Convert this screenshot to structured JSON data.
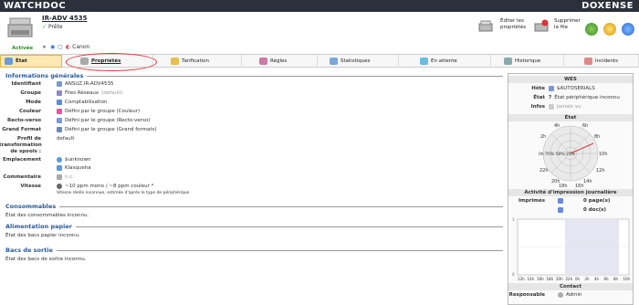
{
  "brand_left": "WATCHDOC",
  "brand_right": "DOXENSE",
  "printer": {
    "name": "IR-ADV 4535",
    "status": "Prête",
    "active_label": "Activée",
    "vendor": "Canon"
  },
  "header_actions": {
    "edit": "Éditer les propriétés",
    "delete": "Supprimer la file"
  },
  "tabs": [
    {
      "label": "État"
    },
    {
      "label": "Propriétés"
    },
    {
      "label": "Tarification"
    },
    {
      "label": "Règles"
    },
    {
      "label": "Statistiques"
    },
    {
      "label": "En attente"
    },
    {
      "label": "Historique"
    },
    {
      "label": "Incidents"
    }
  ],
  "general": {
    "title": "Informations générales",
    "rows": [
      {
        "k": "Identifiant",
        "v": "ANSUZ.IR-ADV4535"
      },
      {
        "k": "Groupe",
        "v": "Files Réseaux",
        "extra": "(default)"
      },
      {
        "k": "Mode",
        "v": "Comptabilisation"
      },
      {
        "k": "Couleur",
        "v": "Défini par le groupe (Couleur)"
      },
      {
        "k": "Recto-verso",
        "v": "Défini par le groupe (Recto-verso)"
      },
      {
        "k": "Grand Format",
        "v": "Défini par le groupe (Grand formats)"
      },
      {
        "k": "Profil de transformation de spools :",
        "v": "default"
      },
      {
        "k": "Emplacement",
        "v": "$unknown",
        "v2": "Klasqueha"
      },
      {
        "k": "Commentaire",
        "v": "n.c."
      },
      {
        "k": "Vitesse",
        "v": "~10 ppm mono / ~8 ppm couleur *",
        "note": "Vitesse réelle inconnue, estimée d'après le type de périphérique"
      }
    ]
  },
  "consumables": {
    "title": "Consommables",
    "text": "État des consommables inconnu."
  },
  "paper_feed": {
    "title": "Alimentation papier",
    "text": "État des bacs papier inconnu."
  },
  "output_bins": {
    "title": "Bacs de sortie",
    "text": "État des bacs de sortie inconnu."
  },
  "side": {
    "title": "WES",
    "host_k": "Hôte",
    "host_v": "$AUTOSERIALS",
    "state_k": "État",
    "state_v": "État périphérique inconnu",
    "info_k": "Infos",
    "info_v": "Jamais vu",
    "state_title": "État",
    "clock": [
      "4h",
      "6h",
      "2h",
      "8h",
      "0h",
      "10h",
      "22h",
      "12h",
      "20h",
      "14h",
      "18h",
      "16h"
    ],
    "clock_center": "0h 75% 50% 25%",
    "activity_title": "Activité d'impression journalière",
    "printed_k": "Imprimés",
    "printed_pages": "0 page(s)",
    "printed_docs": "0 doc(s)",
    "xaxis": [
      "12h",
      "14h",
      "16h",
      "18h",
      "20h",
      "22h",
      "0h",
      "2h",
      "4h",
      "6h",
      "8h",
      "10h"
    ],
    "contact_title": "Contact",
    "resp_k": "Responsable",
    "resp_v": "Admin"
  }
}
